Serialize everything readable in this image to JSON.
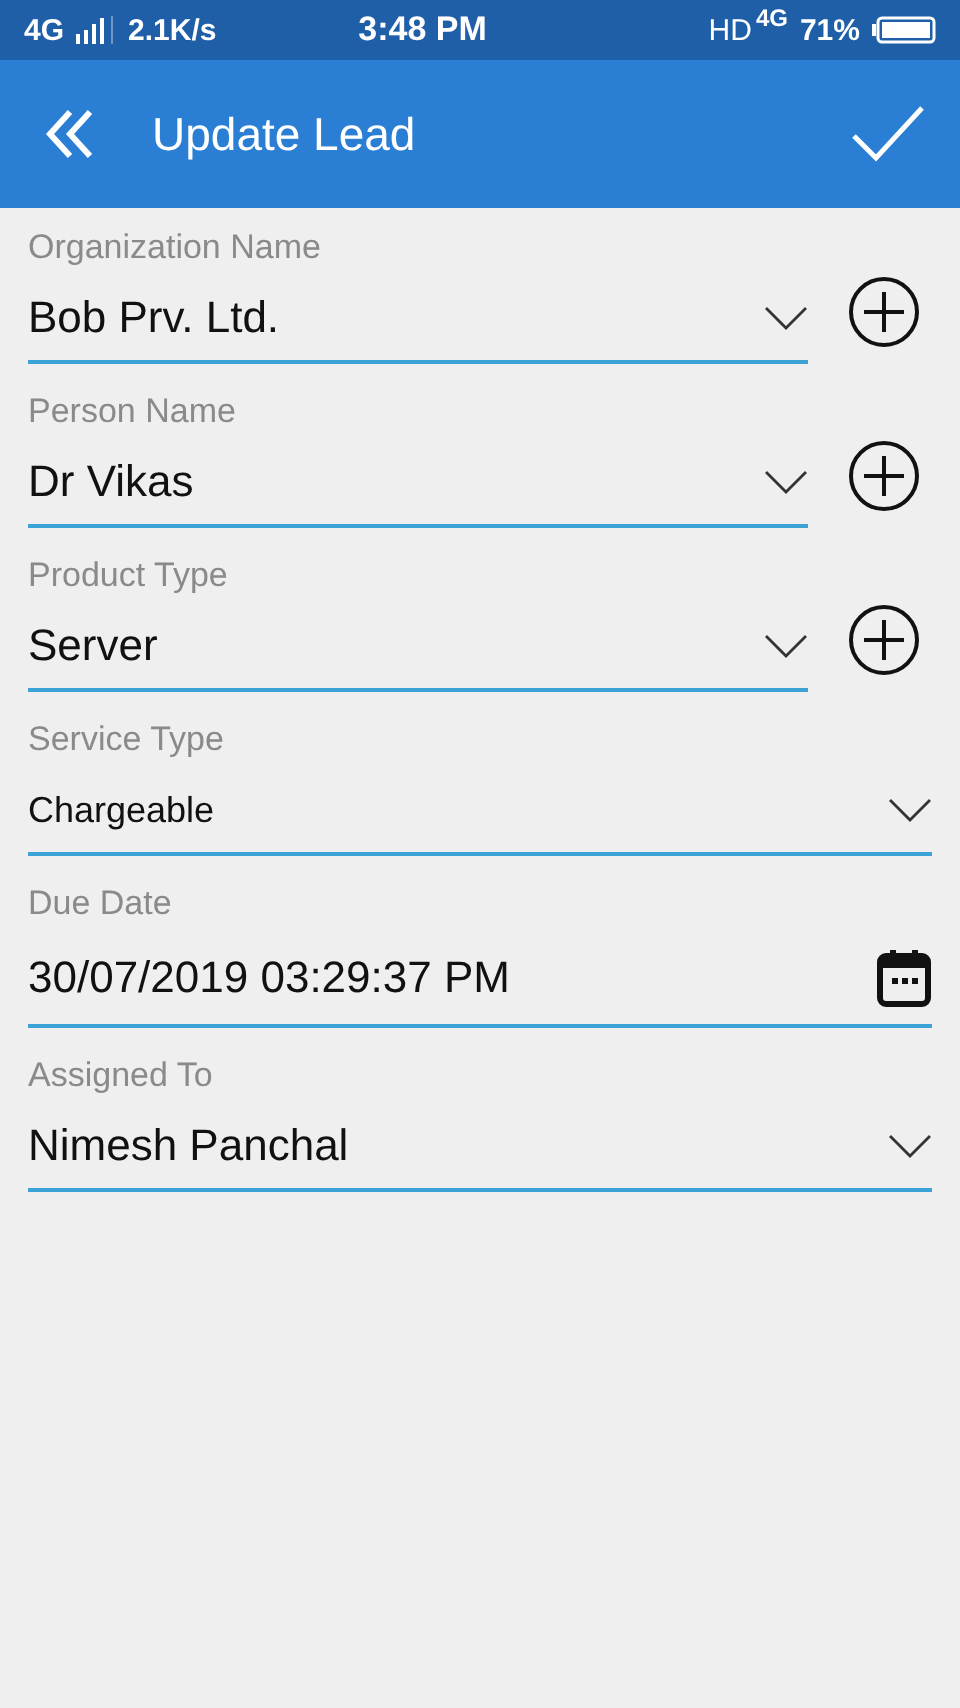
{
  "status_bar": {
    "network": "4G",
    "speed": "2.1K/s",
    "time": "3:48 PM",
    "hd": "HD",
    "network_right": "4G",
    "battery": "71%"
  },
  "toolbar": {
    "title": "Update Lead"
  },
  "fields": [
    {
      "kind": "dropdown",
      "label": "Organization Name",
      "value": "Bob Prv. Ltd.",
      "add_button": true
    },
    {
      "kind": "dropdown",
      "label": "Person Name",
      "value": "Dr Vikas",
      "add_button": true
    },
    {
      "kind": "dropdown",
      "label": "Product Type",
      "value": "Server",
      "add_button": true
    },
    {
      "kind": "spinner",
      "label": "Service Type",
      "value": "Chargeable",
      "add_button": false
    },
    {
      "kind": "date",
      "label": "Due Date",
      "value": "30/07/2019 03:29:37 PM",
      "add_button": false
    },
    {
      "kind": "dropdown",
      "label": "Assigned To",
      "value": "Nimesh Panchal",
      "add_button": false
    }
  ]
}
